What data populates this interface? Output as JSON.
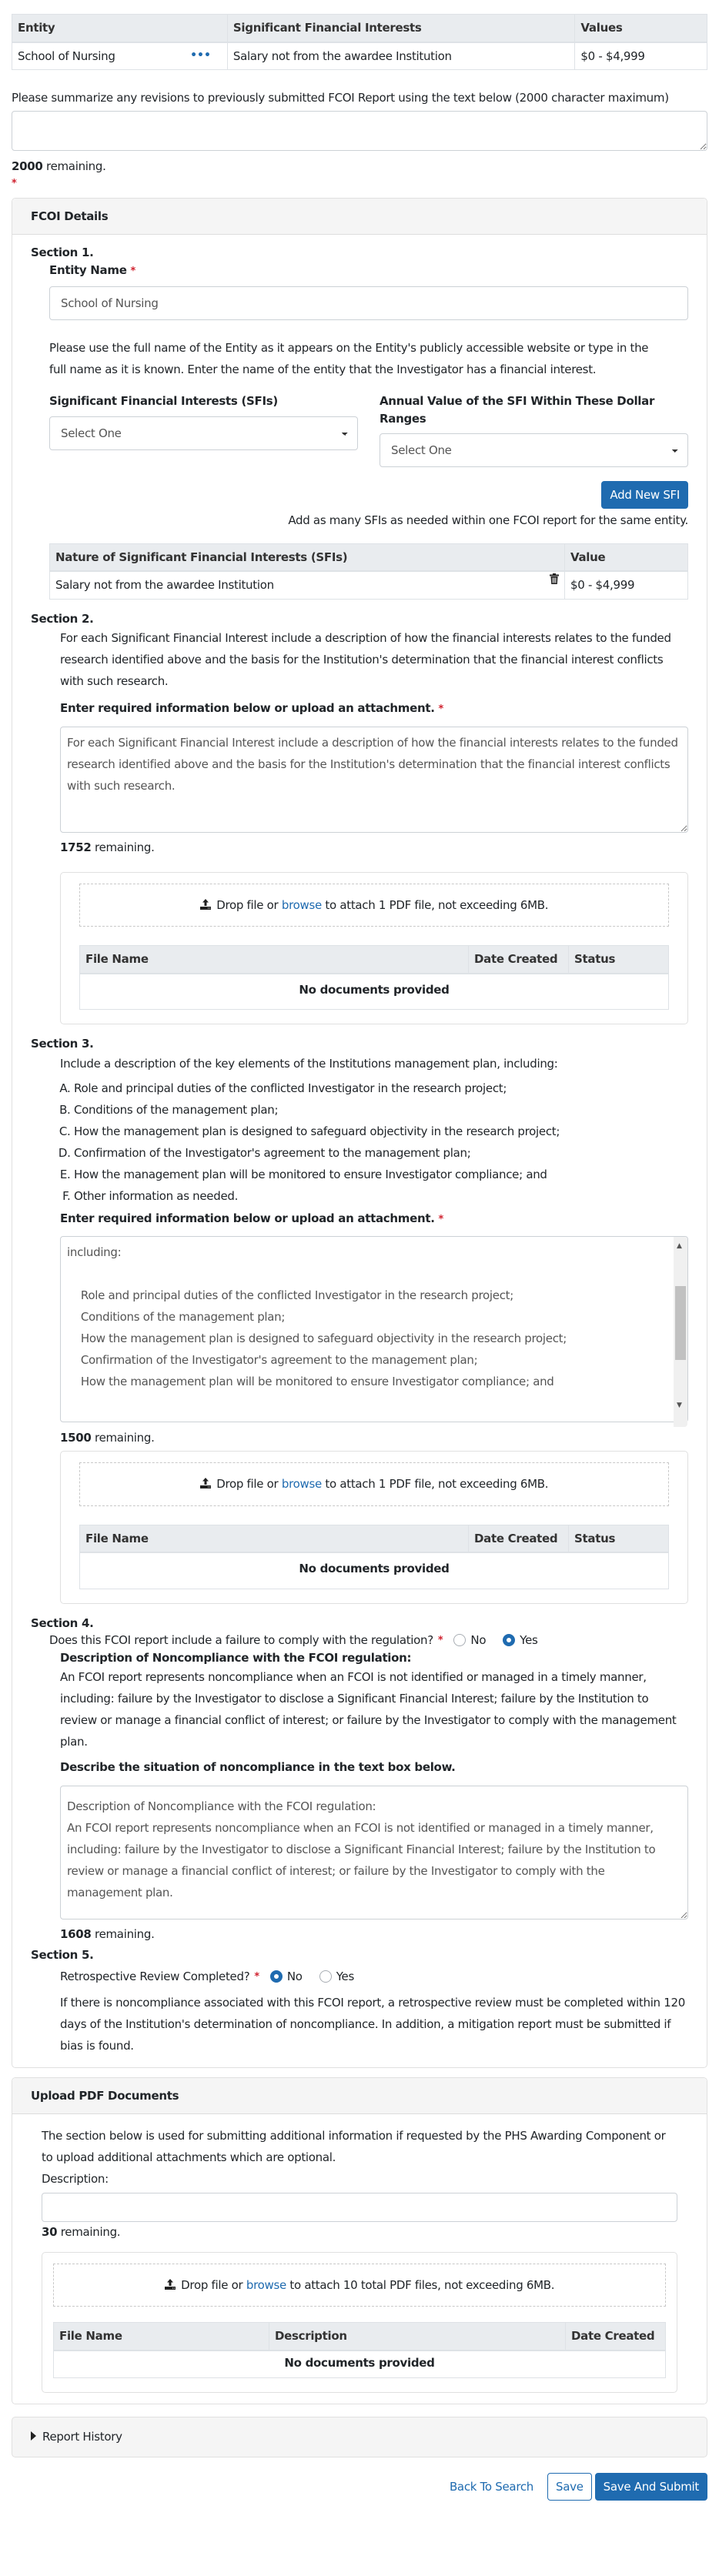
{
  "entity_table": {
    "headers": [
      "Entity",
      "Significant Financial Interests",
      "Values"
    ],
    "rows": [
      {
        "entity": "School of Nursing",
        "sfi": "Salary not from the awardee Institution",
        "value": "$0 - $4,999"
      }
    ],
    "row_menu_icon": "ellipsis-icon"
  },
  "summary": {
    "label": "Please summarize any revisions to previously submitted FCOI Report using the text below (2000 character maximum)",
    "value": "",
    "remaining_count": "2000",
    "remaining_suffix": " remaining."
  },
  "required_marker": "*",
  "fcoi_details": {
    "header": "FCOI Details",
    "section1": {
      "title": "Section 1.",
      "entity_name_label": "Entity Name",
      "entity_name_value": "School of Nursing",
      "help_text": "Please use the full name of the Entity as it appears on the Entity's publicly accessible website or type in the full name as it is known. Enter the name of the entity that the Investigator has a financial interest.",
      "sfi_label": "Significant Financial Interests (SFIs)",
      "sfi_selected": "Select One",
      "annual_value_label": "Annual Value of the SFI Within These Dollar Ranges",
      "annual_value_selected": "Select One",
      "add_button": "Add New SFI",
      "add_note": "Add as many SFIs as needed within one FCOI report for the same entity.",
      "sfi_table": {
        "headers": [
          "Nature of Significant Financial Interests (SFIs)",
          "Value"
        ],
        "rows": [
          {
            "nature": "Salary not from the awardee Institution",
            "value": "$0 - $4,999"
          }
        ],
        "delete_icon": "trash-icon"
      }
    },
    "section2": {
      "title": "Section 2.",
      "instructions": "For each Significant Financial Interest include a description of how the financial interests relates to the funded research identified above and the basis for the Institution's determination that the financial interest conflicts with such research.",
      "field_label": "Enter required information below or upload an attachment.",
      "text_value": "For each Significant Financial Interest include a description of how the financial interests relates to the funded research identified above and the basis for the Institution's determination that the financial interest conflicts with such research.",
      "remaining_count": "1752",
      "remaining_suffix": " remaining.",
      "upload": {
        "drop_prefix": " Drop file or ",
        "browse": "browse",
        "drop_suffix": " to attach 1 PDF file, not exceeding 6MB.",
        "headers": [
          "File Name",
          "Date Created",
          "Status"
        ],
        "empty": "No documents provided"
      }
    },
    "section3": {
      "title": "Section 3.",
      "intro": "Include a description of the key elements of the Institutions management plan, including:",
      "items": [
        "Role and principal duties of the conflicted Investigator in the research project;",
        "Conditions of the management plan;",
        "How the management plan is designed to safeguard objectivity in the research project;",
        "Confirmation of the Investigator's agreement to the management plan;",
        "How the management plan will be monitored to ensure Investigator compliance; and",
        "Other information as needed."
      ],
      "field_label": "Enter required information below or upload an attachment.",
      "text_value": "including:\n\n    Role and principal duties of the conflicted Investigator in the research project;\n    Conditions of the management plan;\n    How the management plan is designed to safeguard objectivity in the research project;\n    Confirmation of the Investigator's agreement to the management plan;\n    How the management plan will be monitored to ensure Investigator compliance; and",
      "remaining_count": "1500",
      "remaining_suffix": " remaining.",
      "upload": {
        "drop_prefix": " Drop file or ",
        "browse": "browse",
        "drop_suffix": " to attach 1 PDF file, not exceeding 6MB.",
        "headers": [
          "File Name",
          "Date Created",
          "Status"
        ],
        "empty": "No documents provided"
      }
    },
    "section4": {
      "title": "Section 4.",
      "question": "Does this FCOI report include a failure to comply with the regulation?",
      "options": [
        "No",
        "Yes"
      ],
      "selected": "Yes",
      "desc_heading": "Description of Noncompliance with the FCOI regulation:",
      "desc_text": "An FCOI report represents noncompliance when an FCOI is not identified or managed in a timely manner, including: failure by the Investigator to disclose a Significant Financial Interest; failure by the Institution to review or manage a financial conflict of interest; or failure by the Investigator to comply with the management plan.",
      "textbox_label": "Describe the situation of noncompliance in the text box below.",
      "text_value": "Description of Noncompliance with the FCOI regulation:\nAn FCOI report represents noncompliance when an FCOI is not identified or managed in a timely manner, including: failure by the Investigator to disclose a Significant Financial Interest; failure by the Institution to review or manage a financial conflict of interest; or failure by the Investigator to comply with the management plan.",
      "remaining_count": "1608",
      "remaining_suffix": " remaining."
    },
    "section5": {
      "title": "Section 5.",
      "question": "Retrospective Review Completed?",
      "options": [
        "No",
        "Yes"
      ],
      "selected": "No",
      "note": "If there is noncompliance associated with this FCOI report, a retrospective review must be completed within 120 days of the Institution's determination of noncompliance. In addition, a mitigation report must be submitted if bias is found."
    }
  },
  "upload_pdf": {
    "header": "Upload PDF Documents",
    "intro": "The section below is used for submitting additional information if requested by the PHS Awarding Component or to upload additional attachments which are optional.",
    "description_label": "Description:",
    "description_value": "",
    "remaining_count": "30",
    "remaining_suffix": " remaining.",
    "upload": {
      "drop_prefix": " Drop file or ",
      "browse": "browse",
      "drop_suffix": " to attach 10 total PDF files, not exceeding 6MB.",
      "headers": [
        "File Name",
        "Description",
        "Date Created"
      ],
      "empty": "No documents provided"
    }
  },
  "report_history": {
    "label": "Report History",
    "icon": "caret-right-icon"
  },
  "actions": {
    "back": "Back To Search",
    "save": "Save",
    "submit": "Save And Submit"
  },
  "colors": {
    "primary": "#1f6bb0",
    "required": "#d0212e",
    "table_header": "#e9ecef",
    "card_header": "#f5f5f5"
  }
}
